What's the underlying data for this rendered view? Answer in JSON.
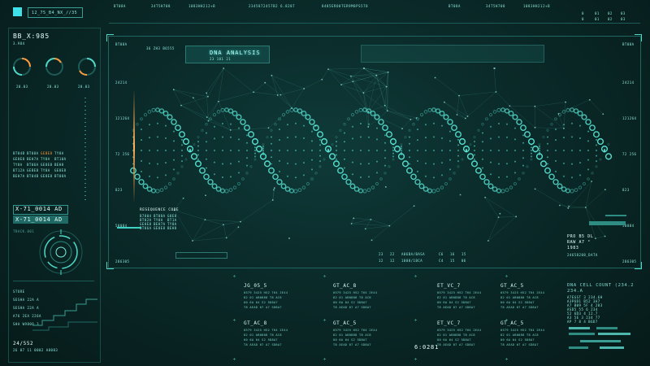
{
  "header": {
    "id_code": "12_75_B4_NX_//35",
    "codes": [
      "BT08A",
      "34T5H708",
      "1083HH212+B",
      "2345872457B2 6.8287",
      "8485ERO0TER9M8PS578",
      "BT08A",
      "34T5H708",
      "1083HH212+B"
    ],
    "grid_digits": [
      "0",
      "01",
      "02",
      "03",
      "0",
      "01",
      "02",
      "03"
    ]
  },
  "left_panel": {
    "title": "BB_X:985",
    "sub": "3.984",
    "gauge_values": [
      "20.03",
      "20.03",
      "20.03"
    ],
    "code_rows": [
      [
        "BT04B",
        "BT08A",
        "GEBE8",
        "TY8A"
      ],
      [
        "GE8E8",
        "BEH7A",
        "TY8A",
        "BT10A"
      ],
      [
        "TY8A",
        "BT06A",
        "GE8E8",
        "BEH8"
      ],
      [
        "BT12A",
        "GEBE8",
        "TY8A",
        "GE8E8"
      ],
      [
        "BEH7A",
        "BT04B",
        "GE8E8",
        "BT08A"
      ]
    ],
    "labels": [
      "X-71_0014 AD",
      "X-71_0014 AD"
    ],
    "radar_caption": "TRACK.001",
    "bottom_rows": [
      "STORE",
      "SESHA 22A A",
      "SESHA 22A A",
      "A76 2EA 226A",
      "SHA W9800 3"
    ],
    "counter": "24/552",
    "counter_sub": "26 07 11 0002 A8083"
  },
  "main": {
    "heading_small": "36 ZH3 B6555",
    "heading": "DNA ANALYSIS",
    "heading_sub": "23 101 21",
    "corner_tl": "BT08A",
    "corner_tr": "BT08A",
    "left_scale": [
      "24214",
      "121264",
      "72 256",
      "823",
      "50084",
      "286305"
    ],
    "right_scale": [
      "24214",
      "121264",
      "72 256",
      "823",
      "50084",
      "286305"
    ],
    "sequence_title": "RESEQUENCE CODE",
    "sequence_rows": [
      [
        "B7804",
        "BT08A",
        "G8E8"
      ],
      [
        "BT02A",
        "TY8A",
        "BT1A"
      ],
      [
        "GE8E8",
        "BEH7A",
        "TY8A"
      ],
      [
        "BT06A",
        "GE8E8",
        "BEH8"
      ]
    ],
    "readout": {
      "l1": "PRO B5 DL",
      "l2": "RAW A7 °",
      "l3": "1983"
    },
    "readout_caption": "24658208_DATA",
    "foot_codes": [
      "23",
      "22",
      "A06BA/BASA",
      "C6",
      "16",
      "15",
      "12",
      "12",
      "1008/1BCA",
      "C4",
      "15",
      "06"
    ]
  },
  "tables": [
    {
      "title": "JG_05_5",
      "rows": [
        "0579 3425 H52 T64 2E44",
        "82 01 AB0888 T8 AC8",
        "00 6A 04 S2 5D8A7",
        "T8 AEAD 07 A7 SD8A7"
      ]
    },
    {
      "title": "GT_AC_8",
      "rows": [
        "0579 3425 H52 T64 2E44",
        "82 01 AB0888 T8 AC8",
        "00 6A 04 S2 5D8A7",
        "T8 AEAD 07 A7 SD8A7"
      ]
    },
    {
      "title": "ET_VC_7",
      "rows": [
        "0579 3425 H52 T64 2E44",
        "82 01 AB0888 T8 AC8",
        "00 6A 04 S2 5D8A7",
        "T8 AEAD 07 A7 SD8A7"
      ]
    },
    {
      "title": "GT_AC_5",
      "rows": [
        "0579 3425 H52 T64 2E44",
        "82 01 AB0888 T8 AC8",
        "00 6A 04 S2 5D8A7",
        "T8 AEAD 07 A7 SD8A7"
      ]
    },
    {
      "title": "GT_AC_8",
      "rows": [
        "0579 3425 H52 T64 2E44",
        "82 01 AB0888 T8 AC8",
        "00 6A 04 S2 5D8A7",
        "T8 AEAD 07 A7 SD8A7"
      ]
    },
    {
      "title": "GT_AC_5",
      "rows": [
        "0579 3425 H52 T64 2E44",
        "82 01 AB0888 T8 AC8",
        "00 6A 04 S2 5D8A7",
        "T8 AEAD 07 A7 SD8A7"
      ]
    },
    {
      "title": "ET_VC_7",
      "rows": [
        "0579 3425 H52 T64 2E44",
        "82 01 AB0888 T8 AC8",
        "00 6A 04 S2 5D8A7",
        "T8 AEAD 07 A7 SD8A7"
      ]
    },
    {
      "title": "GT_AC_5",
      "rows": [
        "0579 3425 H52 T64 2E44",
        "82 01 AB0888 T8 AC8",
        "00 6A 04 S2 5D8A7",
        "T8 AEAD 07 A7 SD8A7"
      ]
    }
  ],
  "bottom": {
    "timer": "6:0281",
    "right_title": "DNA CELL COUNT (234.2",
    "right_sub": "234.A",
    "right_rows": [
      "A7EGST 3 234.6H",
      "A3P6D1 B52 3A7",
      "A7 B09 5F 4 283",
      "ASD5 55 6 234",
      "52 6D3 4 12.7",
      "A3 5E 3 234 77",
      "AP 7 8 4 B6D7"
    ]
  },
  "colors": {
    "accent": "#3ff0e0",
    "helix": "#5ef2e1",
    "orange": "#ff9a3c"
  }
}
